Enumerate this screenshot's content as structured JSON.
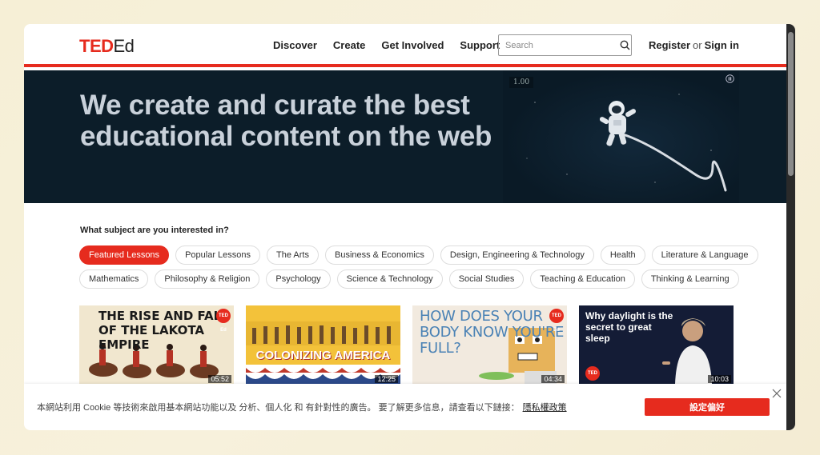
{
  "header": {
    "logo_ted": "TED",
    "logo_ed": "Ed",
    "nav": [
      "Discover",
      "Create",
      "Get Involved",
      "Support"
    ],
    "search_placeholder": "Search",
    "register": "Register",
    "or": "or",
    "signin": "Sign in"
  },
  "hero": {
    "title": "We create and curate the best educational content on the web",
    "video_speed": "1.00"
  },
  "subjects": {
    "question": "What subject are you interested in?",
    "row1": [
      "Featured Lessons",
      "Popular Lessons",
      "The Arts",
      "Business & Economics",
      "Design, Engineering & Technology",
      "Health",
      "Literature & Language"
    ],
    "row2": [
      "Mathematics",
      "Philosophy & Religion",
      "Psychology",
      "Science & Technology",
      "Social Studies",
      "Teaching & Education",
      "Thinking & Learning"
    ]
  },
  "cards": [
    {
      "title": "The Rise and Fall of the Lakota Empire",
      "duration": "05:52",
      "badge": "TED Ed"
    },
    {
      "title": "Colonizing America",
      "duration": "12:25"
    },
    {
      "title": "How does your body know you're full?",
      "duration": "04:34",
      "badge": "TED Ed"
    },
    {
      "title": "Why daylight is the secret to great sleep",
      "duration": "10:03",
      "badge": "TED"
    }
  ],
  "cookie": {
    "text": "本網站利用 Cookie 等技術來啟用基本網站功能以及 分析、個人化 和 有針對性的廣告。 要了解更多信息，請查看以下鏈接：",
    "link": "隱私權政策",
    "button": "設定偏好"
  },
  "colors": {
    "brand_red": "#e62b1e",
    "hero_bg": "#0c1d29"
  }
}
